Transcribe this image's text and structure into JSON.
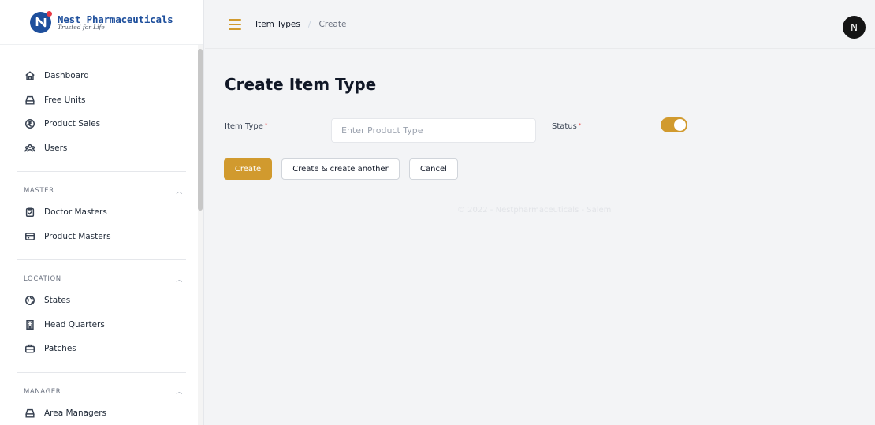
{
  "brand": {
    "name": "Nest Pharmaceuticals",
    "tagline": "Trusted for Life",
    "logo_letter": "N",
    "color": "#1e4f9c"
  },
  "sidebar": {
    "items": [
      {
        "label": "Dashboard",
        "icon": "home-icon"
      },
      {
        "label": "Free Units",
        "icon": "box-icon"
      },
      {
        "label": "Product Sales",
        "icon": "currency-icon"
      },
      {
        "label": "Users",
        "icon": "users-icon"
      }
    ],
    "groups": [
      {
        "title": "MASTER",
        "items": [
          {
            "label": "Doctor Masters",
            "icon": "clipboard-icon"
          },
          {
            "label": "Product Masters",
            "icon": "card-icon"
          }
        ]
      },
      {
        "title": "LOCATION",
        "items": [
          {
            "label": "States",
            "icon": "globe-icon"
          },
          {
            "label": "Head Quarters",
            "icon": "building-icon"
          },
          {
            "label": "Patches",
            "icon": "briefcase-icon"
          }
        ]
      },
      {
        "title": "MANAGER",
        "items": [
          {
            "label": "Area Managers",
            "icon": "box-icon"
          }
        ]
      }
    ]
  },
  "topbar": {
    "breadcrumb": [
      "Item Types",
      "Create"
    ],
    "avatar_letter": "N"
  },
  "main": {
    "title": "Create Item Type",
    "form": {
      "item_type_label": "Item Type",
      "item_type_placeholder": "Enter Product Type",
      "item_type_value": "",
      "status_label": "Status",
      "status_on": true
    },
    "buttons": {
      "create": "Create",
      "create_another": "Create & create another",
      "cancel": "Cancel"
    },
    "footer": "© 2022 - Nestpharmaceuticals - Salem"
  },
  "colors": {
    "accent": "#d19a2e",
    "brand": "#1e4f9c",
    "required": "#ef4444"
  }
}
